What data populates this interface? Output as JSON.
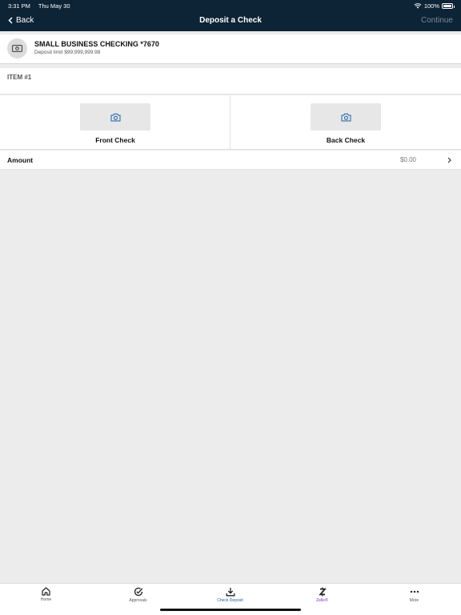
{
  "status_bar": {
    "time": "3:31 PM",
    "date": "Thu May 30",
    "battery": "100%"
  },
  "nav": {
    "back_label": "Back",
    "title": "Deposit a Check",
    "continue_label": "Continue"
  },
  "account": {
    "name": "SMALL BUSINESS CHECKING *7670",
    "limit": "Deposit limit $99,999,999.98",
    "icon": "cash-icon"
  },
  "item": {
    "label": "ITEM #1"
  },
  "checks": {
    "front_label": "Front Check",
    "back_label": "Back Check",
    "icon": "camera-icon"
  },
  "amount": {
    "label": "Amount",
    "value": "$0.00"
  },
  "tabs": [
    {
      "label": "Home",
      "icon": "home-icon"
    },
    {
      "label": "Approvals",
      "icon": "check-circle-icon"
    },
    {
      "label": "Check Deposit",
      "icon": "download-icon"
    },
    {
      "label": "Zelle®",
      "icon": "zelle-icon"
    },
    {
      "label": "More",
      "icon": "more-icon"
    }
  ],
  "colors": {
    "header": "#0d2336",
    "accent": "#1a5fa5",
    "zelle": "#7b2fbf",
    "background": "#ececec"
  }
}
